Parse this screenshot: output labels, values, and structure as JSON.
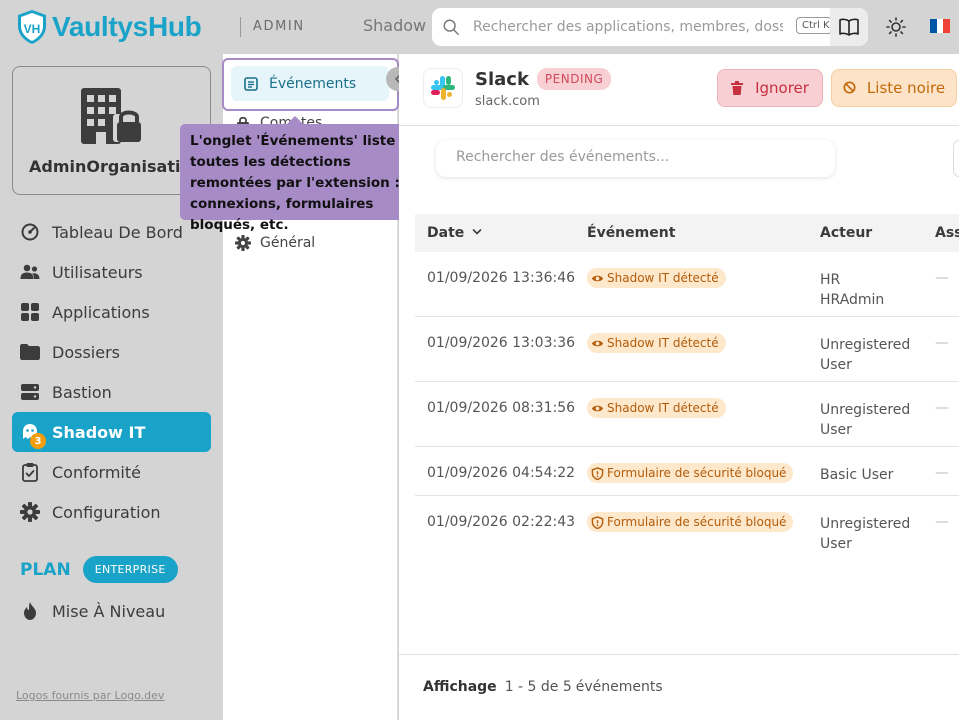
{
  "header": {
    "brand": "VaultysHub",
    "brand_initials": "VH",
    "section": "ADMIN",
    "breadcrumb": "Shadow",
    "search_placeholder": "Rechercher des applications, membres, dossiers...",
    "shortcut": "Ctrl K",
    "icons": [
      "search-icon",
      "book-icon",
      "sun-icon",
      "flag-fr-icon"
    ],
    "flag_colors": [
      "#0055a4",
      "#ffffff",
      "#ef4135"
    ]
  },
  "sidebar": {
    "org_name": "AdminOrganisation",
    "items": [
      {
        "label": "Tableau De Bord",
        "icon": "gauge-icon"
      },
      {
        "label": "Utilisateurs",
        "icon": "users-icon"
      },
      {
        "label": "Applications",
        "icon": "grid-icon"
      },
      {
        "label": "Dossiers",
        "icon": "folder-icon"
      },
      {
        "label": "Bastion",
        "icon": "server-icon"
      },
      {
        "label": "Shadow IT",
        "icon": "ghost-icon",
        "active": true,
        "badge": "3"
      },
      {
        "label": "Conformité",
        "icon": "clipboard-check-icon"
      },
      {
        "label": "Configuration",
        "icon": "gear-icon"
      }
    ],
    "plan_label": "PLAN",
    "plan_badge": "ENTERPRISE",
    "upgrade_label": "Mise À Niveau",
    "footer_link": "Logos fournis par Logo.dev",
    "accent": "#1aa3c9"
  },
  "subnav": {
    "active_label": "Événements",
    "partial_label": "Comptes",
    "general_label": "Général"
  },
  "tooltip": {
    "text": "L'onglet 'Événements' liste toutes les détections remontées par l'extension : connexions, formulaires bloqués, etc."
  },
  "app": {
    "name": "Slack",
    "status": "PENDING",
    "domain": "slack.com",
    "ignore_label": "Ignorer",
    "blacklist_label": "Liste noire"
  },
  "events": {
    "search_placeholder": "Rechercher des événements...",
    "columns": [
      "Date",
      "Événement",
      "Acteur",
      "Ass"
    ],
    "rows": [
      {
        "date": "01/09/2026 13:36:46",
        "event": "Shadow IT détecté",
        "kind": "eye",
        "actor_line1": "HR",
        "actor_line2": "HRAdmin",
        "assoc": "—"
      },
      {
        "date": "01/09/2026 13:03:36",
        "event": "Shadow IT détecté",
        "kind": "eye",
        "actor_line1": "Unregistered",
        "actor_line2": "User",
        "assoc": "—"
      },
      {
        "date": "01/09/2026 08:31:56",
        "event": "Shadow IT détecté",
        "kind": "eye",
        "actor_line1": "Unregistered",
        "actor_line2": "User",
        "assoc": "—"
      },
      {
        "date": "01/09/2026 04:54:22",
        "event": "Formulaire de sécurité bloqué",
        "kind": "shield",
        "actor_line1": "Basic User",
        "actor_line2": "",
        "assoc": "—"
      },
      {
        "date": "01/09/2026 02:22:43",
        "event": "Formulaire de sécurité bloqué",
        "kind": "shield",
        "actor_line1": "Unregistered",
        "actor_line2": "User",
        "assoc": "—"
      }
    ],
    "pager_label": "Affichage",
    "pager_range": "1 - 5 de 5",
    "pager_unit": "événements"
  }
}
